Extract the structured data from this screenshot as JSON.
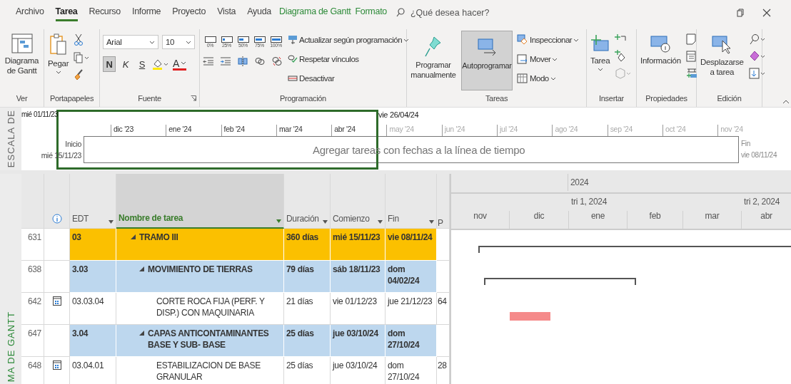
{
  "tabs": [
    {
      "label": "Archivo",
      "selected": false,
      "kind": "normal"
    },
    {
      "label": "Tarea",
      "selected": true,
      "kind": "normal"
    },
    {
      "label": "Recurso",
      "selected": false,
      "kind": "normal"
    },
    {
      "label": "Informe",
      "selected": false,
      "kind": "normal"
    },
    {
      "label": "Proyecto",
      "selected": false,
      "kind": "normal"
    },
    {
      "label": "Vista",
      "selected": false,
      "kind": "normal"
    },
    {
      "label": "Ayuda",
      "selected": false,
      "kind": "normal"
    },
    {
      "label": "Diagrama de Gantt",
      "selected": false,
      "kind": "contextual"
    },
    {
      "label": "Formato",
      "selected": false,
      "kind": "contextual"
    }
  ],
  "search": {
    "placeholder": "¿Qué desea hacer?"
  },
  "ribbon": {
    "view": {
      "label": "Ver",
      "gantt_button": "Diagrama de Gantt"
    },
    "clipboard": {
      "label": "Portapapeles",
      "paste": "Pegar"
    },
    "font": {
      "label": "Fuente",
      "family": "Arial",
      "size": "10",
      "styles": [
        {
          "label": "N",
          "pressed": true
        },
        {
          "label": "K",
          "pressed": false
        },
        {
          "label": "S",
          "pressed": false
        }
      ],
      "font_color": "A"
    },
    "schedule": {
      "label": "Programación",
      "percent": [
        "0%",
        "25%",
        "50%",
        "75%",
        "100%"
      ],
      "commands": [
        "Actualizar según programación",
        "Respetar vínculos",
        "Desactivar"
      ]
    },
    "tasks": {
      "label": "Tareas",
      "modes": [
        {
          "label": "Programar manualmente",
          "selected": false
        },
        {
          "label": "Autoprogramar",
          "selected": true
        }
      ],
      "commands": [
        "Inspeccionar",
        "Mover",
        "Modo"
      ]
    },
    "insert": {
      "label": "Insertar",
      "task": "Tarea"
    },
    "properties": {
      "label": "Propiedades",
      "info": "Información"
    },
    "editing": {
      "label": "Edición",
      "scroll": "Desplazarse a tarea"
    }
  },
  "timeline": {
    "side_label": "ESCALA DE",
    "view_start": "mié 01/11/23",
    "selection_end": "vie 26/04/24",
    "months": [
      {
        "label": "dic '23",
        "in_selection": true
      },
      {
        "label": "ene '24",
        "in_selection": true
      },
      {
        "label": "feb '24",
        "in_selection": true
      },
      {
        "label": "mar '24",
        "in_selection": true
      },
      {
        "label": "abr '24",
        "in_selection": true
      },
      {
        "label": "may '24",
        "in_selection": false
      },
      {
        "label": "jun '24",
        "in_selection": false
      },
      {
        "label": "jul '24",
        "in_selection": false
      },
      {
        "label": "ago '24",
        "in_selection": false
      },
      {
        "label": "sep '24",
        "in_selection": false
      },
      {
        "label": "oct '24",
        "in_selection": false
      },
      {
        "label": "nov '24",
        "in_selection": false
      }
    ],
    "start_label": "Inicio",
    "start_date": "mié 15/11/23",
    "placeholder": "Agregar tareas con fechas a la línea de tiempo",
    "finish_label": "Fin",
    "finish_date": "vie 08/11/24"
  },
  "gantt_label": "MA DE GANTT",
  "table": {
    "columns": [
      {
        "label": "EDT",
        "selected": false
      },
      {
        "label": "Nombre de tarea",
        "selected": true
      },
      {
        "label": "Duración",
        "selected": false
      },
      {
        "label": "Comienzo",
        "selected": false
      },
      {
        "label": "Fin",
        "selected": false
      },
      {
        "label": "P",
        "selected": false
      }
    ],
    "rows": [
      {
        "id": "631",
        "wbs": "03",
        "name": "TRAMO III",
        "duration": "360 días",
        "start": "mié 15/11/23",
        "finish": "vie 08/11/24",
        "kind": "summary",
        "expanded": true,
        "calendar_indicator": false,
        "children": [
          {
            "id": "638",
            "wbs": "3.03",
            "name": "MOVIMIENTO DE TIERRAS",
            "duration": "79 días",
            "start": "sáb 18/11/23",
            "finish": "dom 04/02/24",
            "kind": "summary",
            "expanded": true,
            "calendar_indicator": false,
            "children": [
              {
                "id": "642",
                "wbs": "03.03.04",
                "name": "CORTE ROCA FIJA (PERF. Y DISP.) CON MAQUINARIA",
                "duration": "21 días",
                "start": "vie 01/12/23",
                "finish": "jue 21/12/23",
                "column_8": "64",
                "kind": "task",
                "calendar_indicator": true
              }
            ]
          },
          {
            "id": "647",
            "wbs": "3.04",
            "name": "CAPAS ANTICONTAMINANTES BASE Y SUB- BASE",
            "duration": "25 días",
            "start": "jue 03/10/24",
            "finish": "dom 27/10/24",
            "kind": "summary",
            "expanded": true,
            "calendar_indicator": false,
            "children": [
              {
                "id": "648",
                "wbs": "03.04.01",
                "name": "ESTABILIZACION DE BASE GRANULAR",
                "duration": "25 días",
                "start": "jue 03/10/24",
                "finish": "dom 27/10/24",
                "column_8": "28",
                "kind": "task",
                "calendar_indicator": true
              }
            ]
          }
        ]
      }
    ]
  },
  "chart": {
    "year": "2024",
    "quarters": [
      "tri 1, 2024",
      "tri 2, 2024"
    ],
    "months": [
      "nov",
      "dic",
      "ene",
      "feb",
      "mar",
      "abr"
    ]
  }
}
